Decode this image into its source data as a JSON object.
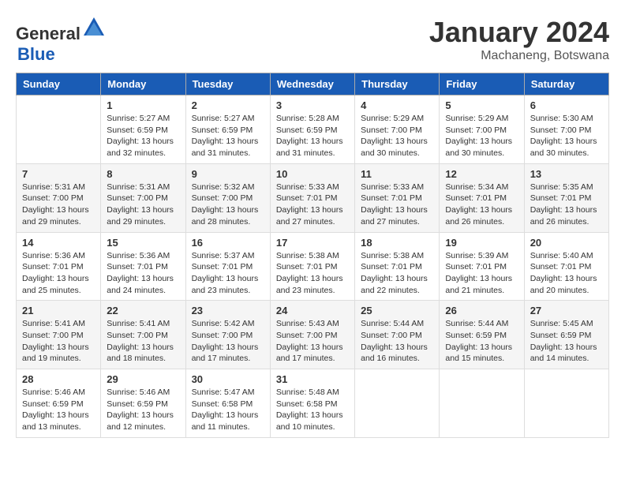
{
  "header": {
    "logo_general": "General",
    "logo_blue": "Blue",
    "month": "January 2024",
    "location": "Machaneng, Botswana"
  },
  "weekdays": [
    "Sunday",
    "Monday",
    "Tuesday",
    "Wednesday",
    "Thursday",
    "Friday",
    "Saturday"
  ],
  "weeks": [
    [
      {
        "day": "",
        "info": ""
      },
      {
        "day": "1",
        "info": "Sunrise: 5:27 AM\nSunset: 6:59 PM\nDaylight: 13 hours\nand 32 minutes."
      },
      {
        "day": "2",
        "info": "Sunrise: 5:27 AM\nSunset: 6:59 PM\nDaylight: 13 hours\nand 31 minutes."
      },
      {
        "day": "3",
        "info": "Sunrise: 5:28 AM\nSunset: 6:59 PM\nDaylight: 13 hours\nand 31 minutes."
      },
      {
        "day": "4",
        "info": "Sunrise: 5:29 AM\nSunset: 7:00 PM\nDaylight: 13 hours\nand 30 minutes."
      },
      {
        "day": "5",
        "info": "Sunrise: 5:29 AM\nSunset: 7:00 PM\nDaylight: 13 hours\nand 30 minutes."
      },
      {
        "day": "6",
        "info": "Sunrise: 5:30 AM\nSunset: 7:00 PM\nDaylight: 13 hours\nand 30 minutes."
      }
    ],
    [
      {
        "day": "7",
        "info": "Sunrise: 5:31 AM\nSunset: 7:00 PM\nDaylight: 13 hours\nand 29 minutes."
      },
      {
        "day": "8",
        "info": "Sunrise: 5:31 AM\nSunset: 7:00 PM\nDaylight: 13 hours\nand 29 minutes."
      },
      {
        "day": "9",
        "info": "Sunrise: 5:32 AM\nSunset: 7:00 PM\nDaylight: 13 hours\nand 28 minutes."
      },
      {
        "day": "10",
        "info": "Sunrise: 5:33 AM\nSunset: 7:01 PM\nDaylight: 13 hours\nand 27 minutes."
      },
      {
        "day": "11",
        "info": "Sunrise: 5:33 AM\nSunset: 7:01 PM\nDaylight: 13 hours\nand 27 minutes."
      },
      {
        "day": "12",
        "info": "Sunrise: 5:34 AM\nSunset: 7:01 PM\nDaylight: 13 hours\nand 26 minutes."
      },
      {
        "day": "13",
        "info": "Sunrise: 5:35 AM\nSunset: 7:01 PM\nDaylight: 13 hours\nand 26 minutes."
      }
    ],
    [
      {
        "day": "14",
        "info": "Sunrise: 5:36 AM\nSunset: 7:01 PM\nDaylight: 13 hours\nand 25 minutes."
      },
      {
        "day": "15",
        "info": "Sunrise: 5:36 AM\nSunset: 7:01 PM\nDaylight: 13 hours\nand 24 minutes."
      },
      {
        "day": "16",
        "info": "Sunrise: 5:37 AM\nSunset: 7:01 PM\nDaylight: 13 hours\nand 23 minutes."
      },
      {
        "day": "17",
        "info": "Sunrise: 5:38 AM\nSunset: 7:01 PM\nDaylight: 13 hours\nand 23 minutes."
      },
      {
        "day": "18",
        "info": "Sunrise: 5:38 AM\nSunset: 7:01 PM\nDaylight: 13 hours\nand 22 minutes."
      },
      {
        "day": "19",
        "info": "Sunrise: 5:39 AM\nSunset: 7:01 PM\nDaylight: 13 hours\nand 21 minutes."
      },
      {
        "day": "20",
        "info": "Sunrise: 5:40 AM\nSunset: 7:01 PM\nDaylight: 13 hours\nand 20 minutes."
      }
    ],
    [
      {
        "day": "21",
        "info": "Sunrise: 5:41 AM\nSunset: 7:00 PM\nDaylight: 13 hours\nand 19 minutes."
      },
      {
        "day": "22",
        "info": "Sunrise: 5:41 AM\nSunset: 7:00 PM\nDaylight: 13 hours\nand 18 minutes."
      },
      {
        "day": "23",
        "info": "Sunrise: 5:42 AM\nSunset: 7:00 PM\nDaylight: 13 hours\nand 17 minutes."
      },
      {
        "day": "24",
        "info": "Sunrise: 5:43 AM\nSunset: 7:00 PM\nDaylight: 13 hours\nand 17 minutes."
      },
      {
        "day": "25",
        "info": "Sunrise: 5:44 AM\nSunset: 7:00 PM\nDaylight: 13 hours\nand 16 minutes."
      },
      {
        "day": "26",
        "info": "Sunrise: 5:44 AM\nSunset: 6:59 PM\nDaylight: 13 hours\nand 15 minutes."
      },
      {
        "day": "27",
        "info": "Sunrise: 5:45 AM\nSunset: 6:59 PM\nDaylight: 13 hours\nand 14 minutes."
      }
    ],
    [
      {
        "day": "28",
        "info": "Sunrise: 5:46 AM\nSunset: 6:59 PM\nDaylight: 13 hours\nand 13 minutes."
      },
      {
        "day": "29",
        "info": "Sunrise: 5:46 AM\nSunset: 6:59 PM\nDaylight: 13 hours\nand 12 minutes."
      },
      {
        "day": "30",
        "info": "Sunrise: 5:47 AM\nSunset: 6:58 PM\nDaylight: 13 hours\nand 11 minutes."
      },
      {
        "day": "31",
        "info": "Sunrise: 5:48 AM\nSunset: 6:58 PM\nDaylight: 13 hours\nand 10 minutes."
      },
      {
        "day": "",
        "info": ""
      },
      {
        "day": "",
        "info": ""
      },
      {
        "day": "",
        "info": ""
      }
    ]
  ]
}
